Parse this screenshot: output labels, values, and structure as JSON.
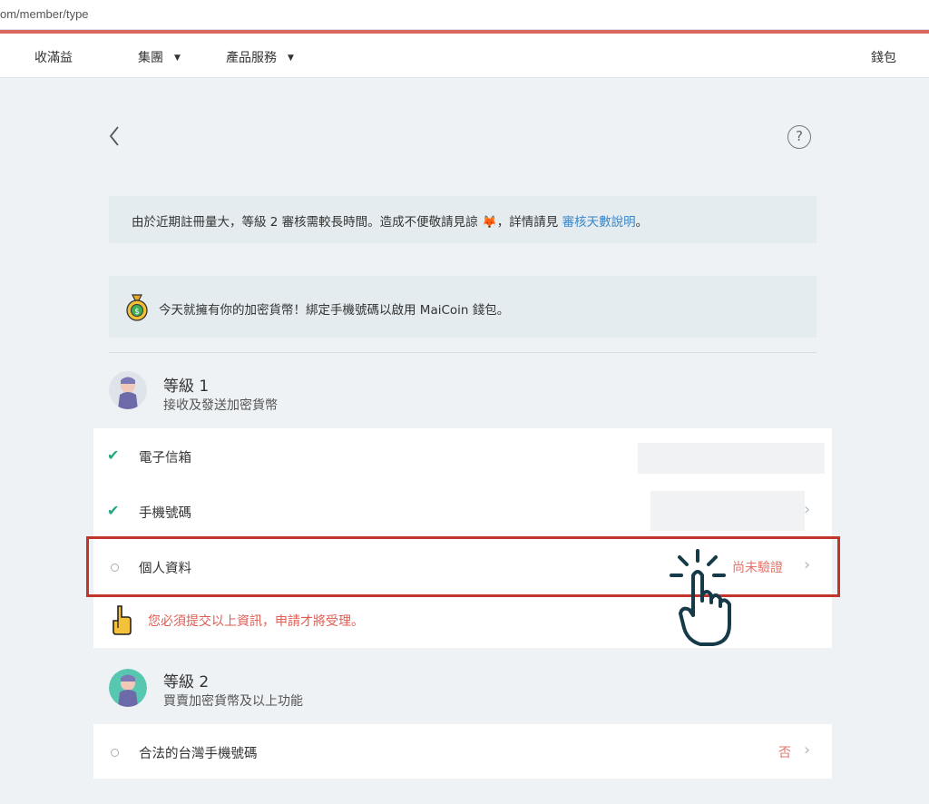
{
  "browser": {
    "url_visible": "om/member/type"
  },
  "nav": {
    "items": [
      {
        "label": "收滿益"
      },
      {
        "label": "集團"
      },
      {
        "label": "產品服務"
      },
      {
        "label": "錢包"
      }
    ]
  },
  "notices": {
    "review": {
      "text": "由於近期註冊量大，等級 2 審核需較長時間。造成不便敬請見諒 ",
      "suffix": "，詳情請見 ",
      "link": "審核天數說明",
      "end": "。"
    },
    "bind": {
      "text": "今天就擁有你的加密貨幣！綁定手機號碼以啟用 MaiCoin 錢包。"
    }
  },
  "levels": [
    {
      "title": "等級 1",
      "subtitle": "接收及發送加密貨幣",
      "items": [
        {
          "label": "電子信箱",
          "status": "verified"
        },
        {
          "label": "手機號碼",
          "status": "verified"
        },
        {
          "label": "個人資料",
          "status": "pending",
          "status_text": "尚未驗證"
        }
      ],
      "warning": "您必須提交以上資訊，申請才將受理。"
    },
    {
      "title": "等級 2",
      "subtitle": "買賣加密貨幣及以上功能",
      "items": [
        {
          "label": "合法的台灣手機號碼",
          "status": "no",
          "status_text": "否"
        }
      ]
    }
  ],
  "colors": {
    "accent_red": "#e3746b",
    "check_green": "#1ea980",
    "link_blue": "#3a86c8",
    "highlight_border": "#c2352b"
  },
  "icons": [
    "back-arrow-icon",
    "help-icon",
    "fox-emoji-icon",
    "money-bag-icon",
    "check-icon",
    "chevron-right-icon",
    "pointing-hand-icon",
    "tap-hand-icon"
  ]
}
